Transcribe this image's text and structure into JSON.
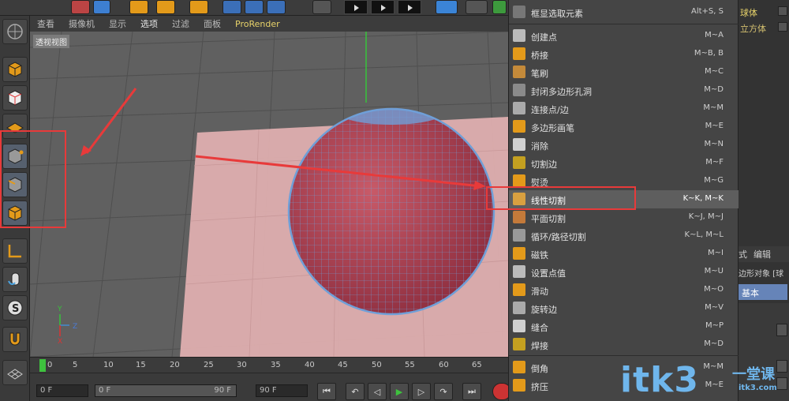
{
  "menubar": {
    "items": [
      "查看",
      "摄像机",
      "显示",
      "选项",
      "过滤",
      "面板",
      "ProRender"
    ]
  },
  "viewport": {
    "label": "透视视图",
    "axes": {
      "y": "Y",
      "z": "Z",
      "x": "X"
    }
  },
  "timeline": {
    "ticks": [
      "0",
      "5",
      "10",
      "15",
      "20",
      "25",
      "30",
      "35",
      "40",
      "45",
      "50",
      "55",
      "60",
      "65"
    ]
  },
  "playback": {
    "current_frame": "0 F",
    "range_start": "0 F",
    "range_end": "90 F",
    "max_frame": "90 F"
  },
  "context_menu": {
    "items": [
      {
        "label": "框显选取元素",
        "shortcut": "Alt+S, S",
        "icon": "frame-select-icon"
      },
      {
        "label": "创建点",
        "shortcut": "M~A",
        "icon": "create-point-icon"
      },
      {
        "label": "桥接",
        "shortcut": "M~B, B",
        "icon": "bridge-icon"
      },
      {
        "label": "笔刷",
        "shortcut": "M~C",
        "icon": "brush-icon"
      },
      {
        "label": "封闭多边形孔洞",
        "shortcut": "M~D",
        "icon": "close-hole-icon"
      },
      {
        "label": "连接点/边",
        "shortcut": "M~M",
        "icon": "connect-icon"
      },
      {
        "label": "多边形画笔",
        "shortcut": "M~E",
        "icon": "polygon-pen-icon"
      },
      {
        "label": "消除",
        "shortcut": "M~N",
        "icon": "dissolve-icon"
      },
      {
        "label": "切割边",
        "shortcut": "M~F",
        "icon": "edge-cut-icon"
      },
      {
        "label": "熨烫",
        "shortcut": "M~G",
        "icon": "iron-icon"
      },
      {
        "label": "线性切割",
        "shortcut": "K~K, M~K",
        "icon": "knife-icon"
      },
      {
        "label": "平面切割",
        "shortcut": "K~J, M~J",
        "icon": "plane-cut-icon"
      },
      {
        "label": "循环/路径切割",
        "shortcut": "K~L, M~L",
        "icon": "loop-cut-icon"
      },
      {
        "label": "磁铁",
        "shortcut": "M~I",
        "icon": "magnet-icon"
      },
      {
        "label": "设置点值",
        "shortcut": "M~U",
        "icon": "set-point-icon"
      },
      {
        "label": "滑动",
        "shortcut": "M~O",
        "icon": "slide-icon"
      },
      {
        "label": "旋转边",
        "shortcut": "M~V",
        "icon": "spin-edge-icon"
      },
      {
        "label": "缝合",
        "shortcut": "M~P",
        "icon": "stitch-icon"
      },
      {
        "label": "焊接",
        "shortcut": "M~D",
        "icon": "weld-icon"
      },
      {
        "label": "倒角",
        "shortcut": "M~M",
        "icon": "bevel-icon"
      },
      {
        "label": "挤压",
        "shortcut": "M~E",
        "icon": "extrude-icon"
      }
    ],
    "highlighted": "线性切割"
  },
  "right_panel": {
    "object_names": [
      "球体",
      "立方体"
    ],
    "tabs": [
      "式",
      "编辑"
    ],
    "object_type": "边形对象 [球",
    "basic_tab": "基本"
  },
  "watermark": {
    "text": "itk3",
    "suffix": "一堂课",
    "site": "itk3.com"
  },
  "colors": {
    "sphere": "#b54a5a",
    "sphere_edge": "#6f9fd8",
    "plane": "#e6b3b4",
    "highlight_box": "#e83a3a",
    "watermark": "#6fb6ec"
  }
}
